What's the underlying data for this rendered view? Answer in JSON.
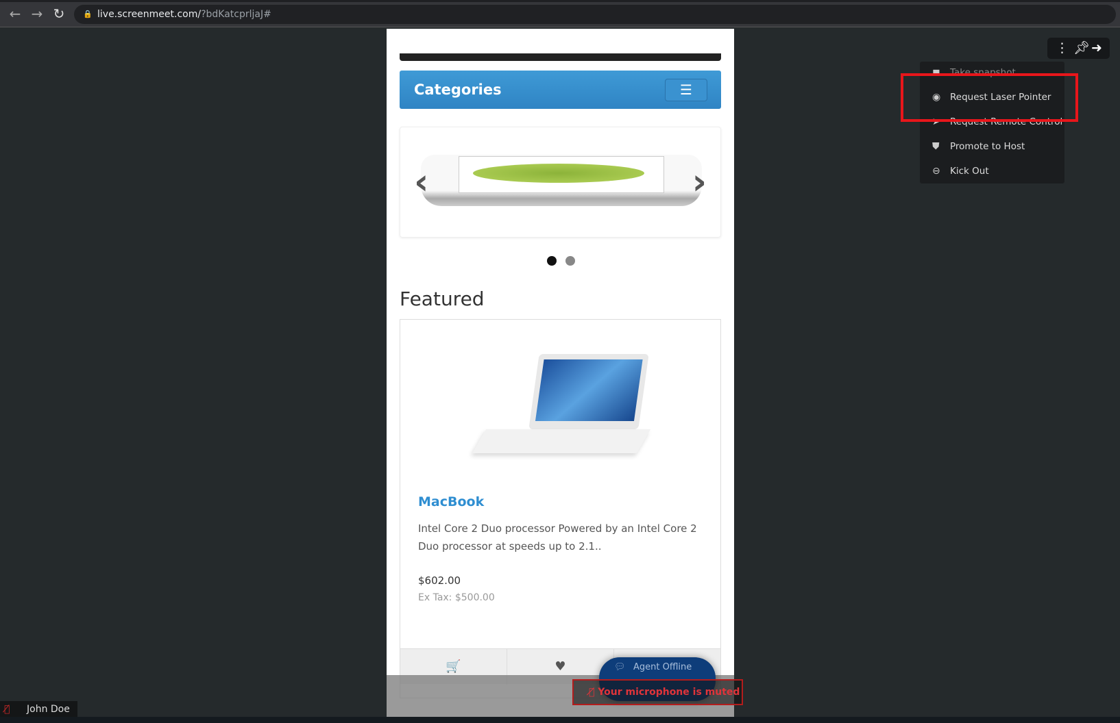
{
  "browser": {
    "url_host": "live.screenmeet.com/",
    "url_rest": "?bdKatcprljaJ#"
  },
  "page": {
    "categories_label": "Categories",
    "featured_heading": "Featured",
    "product": {
      "title": "MacBook",
      "description": "Intel Core 2 Duo processor Powered by an Intel Core 2 Duo processor at speeds up to 2.1..",
      "price": "$602.00",
      "ex_tax": "Ex Tax: $500.00"
    },
    "carousel": {
      "slides": 2,
      "active": 1
    },
    "agent_label": "Agent Offline"
  },
  "mute_notice": "Your microphone is muted",
  "menu": {
    "items": [
      {
        "label": "Take snapshot",
        "icon": "camera-icon"
      },
      {
        "label": "Request Laser Pointer",
        "icon": "target-icon"
      },
      {
        "label": "Request Remote Control",
        "icon": "cursor-icon"
      },
      {
        "label": "Promote to Host",
        "icon": "shield-icon"
      },
      {
        "label": "Kick Out",
        "icon": "minus-circle-icon"
      }
    ]
  },
  "participant": {
    "name": "John Doe",
    "muted": true
  },
  "colors": {
    "accent": "#2f8ed1",
    "highlight": "#e8161b",
    "muted": "#e0343a"
  }
}
